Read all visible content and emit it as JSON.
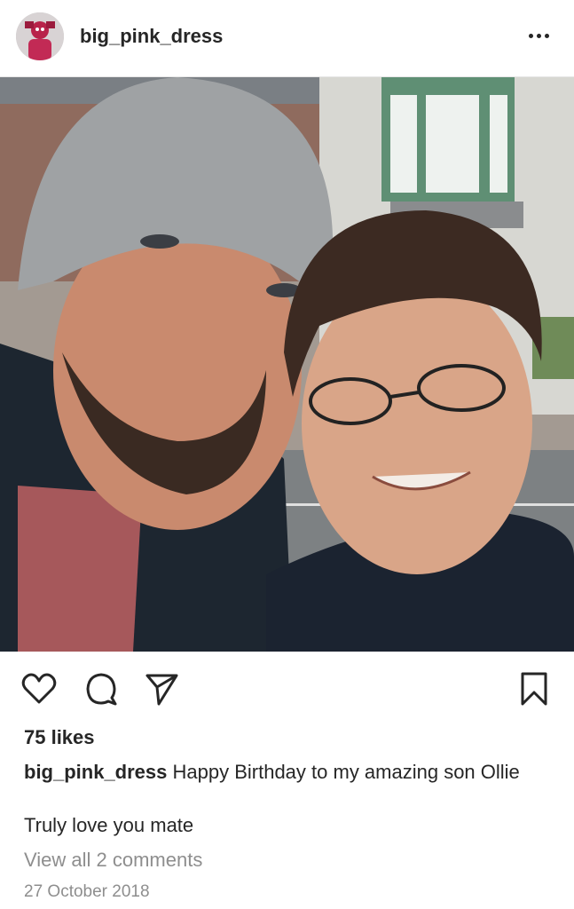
{
  "header": {
    "username": "big_pink_dress",
    "avatar_icon": "avatar-icon",
    "more_icon": "more-options-icon"
  },
  "post": {
    "photo_description_colors": {
      "sky": "#c8c9c6",
      "wall": "#9a8f86",
      "window_frame": "#4d8a66",
      "road": "#7f8382",
      "beanie": "#9ea1a3",
      "jacket": "#1f2a37"
    }
  },
  "actions": {
    "like_icon": "heart-icon",
    "comment_icon": "comment-icon",
    "share_icon": "share-icon",
    "save_icon": "bookmark-icon"
  },
  "likes": "75 likes",
  "caption": {
    "user": "big_pink_dress",
    "text_line1": " Happy Birthday to my amazing son Ollie",
    "text_line2": "Truly love you mate"
  },
  "view_comments": "View all 2 comments",
  "date": "27 October 2018"
}
